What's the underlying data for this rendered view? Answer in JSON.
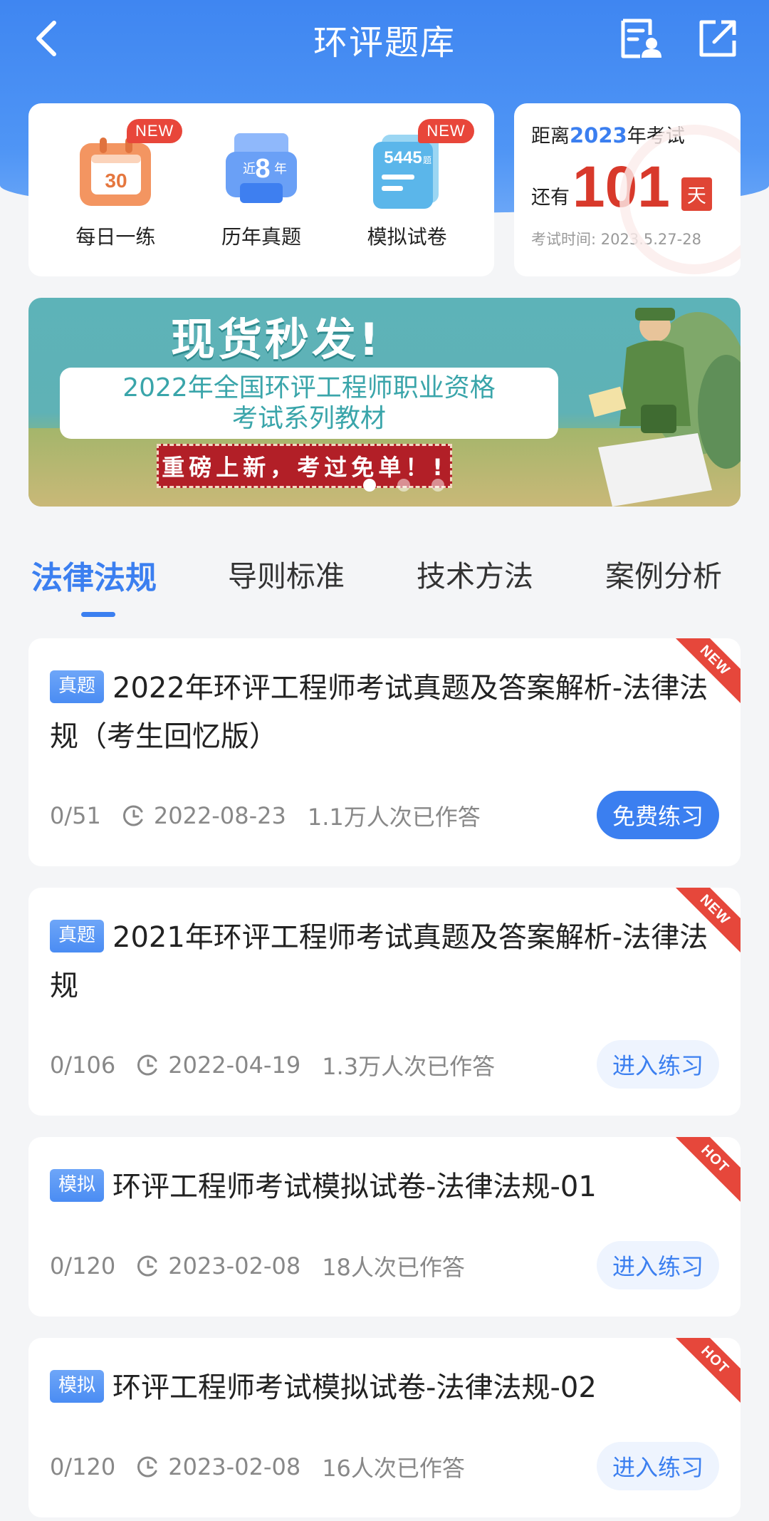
{
  "header": {
    "title": "环评题库",
    "icons": [
      "back-icon",
      "profile-list-icon",
      "share-icon"
    ]
  },
  "quick": {
    "items": [
      {
        "label": "每日一练",
        "badge": "NEW",
        "icon_text": "30"
      },
      {
        "label": "历年真题",
        "badge": "",
        "icon_text_pre": "近",
        "icon_text_num": "8",
        "icon_text_post": "年"
      },
      {
        "label": "模拟试卷",
        "badge": "NEW",
        "icon_text": "5445",
        "icon_text_suffix": "题"
      }
    ]
  },
  "countdown": {
    "prefix": "距离",
    "year": "2023",
    "suffix": "年考试",
    "remain_label": "还有",
    "days": "101",
    "day_unit": "天",
    "exam_time": "考试时间: 2023.5.27-28"
  },
  "banner": {
    "headline": "现货秒发!",
    "sub_line1": "2022年全国环评工程师职业资格",
    "sub_line2": "考试系列教材",
    "stamp": "重磅上新，考过免单！!",
    "active_dot": 0
  },
  "tabs": [
    {
      "label": "法律法规",
      "active": true
    },
    {
      "label": "导则标准",
      "active": false
    },
    {
      "label": "技术方法",
      "active": false
    },
    {
      "label": "案例分析",
      "active": false
    }
  ],
  "list": [
    {
      "tag": "真题",
      "title": "2022年环评工程师考试真题及答案解析-法律法规（考生回忆版）",
      "progress": "0/51",
      "date": "2022-08-23",
      "count": "1.1万人次已作答",
      "button": "免费练习",
      "button_style": "primary",
      "ribbon": "NEW"
    },
    {
      "tag": "真题",
      "title": "2021年环评工程师考试真题及答案解析-法律法规",
      "progress": "0/106",
      "date": "2022-04-19",
      "count": "1.3万人次已作答",
      "button": "进入练习",
      "button_style": "secondary",
      "ribbon": "NEW"
    },
    {
      "tag": "模拟",
      "title": "环评工程师考试模拟试卷-法律法规-01",
      "progress": "0/120",
      "date": "2023-02-08",
      "count": "18人次已作答",
      "button": "进入练习",
      "button_style": "secondary",
      "ribbon": "HOT"
    },
    {
      "tag": "模拟",
      "title": "环评工程师考试模拟试卷-法律法规-02",
      "progress": "0/120",
      "date": "2023-02-08",
      "count": "16人次已作答",
      "button": "进入练习",
      "button_style": "secondary",
      "ribbon": "HOT"
    }
  ],
  "colors": {
    "accent": "#3b7ff0",
    "danger": "#e6473b",
    "background": "#f4f5f7"
  }
}
